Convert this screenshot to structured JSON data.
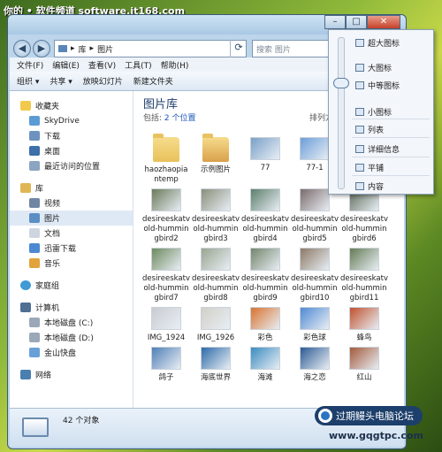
{
  "watermark": {
    "top_text": "你的 • 软件频道 software.it168.com",
    "badge_text": "过期鳗头电脑论坛",
    "url": "www.gqgtpc.com"
  },
  "window": {
    "buttons": [
      "–",
      "□",
      "✕"
    ]
  },
  "address": {
    "crumb1": "库",
    "sep": "▸",
    "crumb2": "图片",
    "search_placeholder": "搜索 图片"
  },
  "menu": [
    "文件(F)",
    "编辑(E)",
    "查看(V)",
    "工具(T)",
    "帮助(H)"
  ],
  "toolbar": [
    "组织 ▾",
    "共享 ▾",
    "放映幻灯片",
    "新建文件夹"
  ],
  "nav": {
    "favorites": "收藏夹",
    "fav_items": [
      "SkyDrive",
      "下载",
      "桌面",
      "最近访问的位置"
    ],
    "library": "库",
    "lib_items": [
      "视频",
      "图片",
      "文档",
      "迅雷下载",
      "音乐"
    ],
    "homegroup": "家庭组",
    "computer": "计算机",
    "comp_items": [
      "本地磁盘 (C:)",
      "本地磁盘 (D:)",
      "金山快盘"
    ],
    "network": "网络"
  },
  "library": {
    "title": "图片库",
    "subtitle_prefix": "包括: ",
    "subtitle_link": "2 个位置",
    "arrange": "排列方"
  },
  "files": [
    {
      "name": "haozhaopiantemp",
      "kind": "folder",
      "color": "#e8c15b"
    },
    {
      "name": "示例图片",
      "kind": "folder",
      "color": "#d9a04a"
    },
    {
      "name": "77",
      "kind": "image",
      "color": "#7aa0c8"
    },
    {
      "name": "77-1",
      "kind": "image",
      "color": "#6c9ed8"
    },
    {
      "name": "",
      "kind": "blank",
      "color": "#ffffff"
    },
    {
      "name": "desireeskatvold-hummingbird2",
      "kind": "image",
      "color": "#6b7a5a"
    },
    {
      "name": "desireeskatvold-hummingbird3",
      "kind": "image",
      "color": "#8a8f7a"
    },
    {
      "name": "desireeskatvold-hummingbird4",
      "kind": "image",
      "color": "#5d7f6a"
    },
    {
      "name": "desireeskatvold-hummingbird5",
      "kind": "image",
      "color": "#7b6b6b"
    },
    {
      "name": "desireeskatvold-hummingbird6",
      "kind": "image",
      "color": "#5f6a58"
    },
    {
      "name": "desireeskatvold-hummingbird7",
      "kind": "image",
      "color": "#6d8a5e"
    },
    {
      "name": "desireeskatvold-hummingbird8",
      "kind": "image",
      "color": "#9aa590"
    },
    {
      "name": "desireeskatvold-hummingbird9",
      "kind": "image",
      "color": "#73856b"
    },
    {
      "name": "desireeskatvold-hummingbird10",
      "kind": "image",
      "color": "#8d7a66"
    },
    {
      "name": "desireeskatvold-hummingbird11",
      "kind": "image",
      "color": "#667c56"
    },
    {
      "name": "IMG_1924",
      "kind": "image",
      "color": "#c9ccd1"
    },
    {
      "name": "IMG_1926",
      "kind": "image",
      "color": "#d2cfc8"
    },
    {
      "name": "彩色",
      "kind": "image",
      "color": "#d8732f"
    },
    {
      "name": "彩色球",
      "kind": "image",
      "color": "#4f8ad3"
    },
    {
      "name": "蜂鸟",
      "kind": "image",
      "color": "#c0522f"
    },
    {
      "name": "鸽子",
      "kind": "image",
      "color": "#4f7fb6"
    },
    {
      "name": "海底世界",
      "kind": "image",
      "color": "#2d6aa8"
    },
    {
      "name": "海滩",
      "kind": "image",
      "color": "#3a8cc0"
    },
    {
      "name": "海之恋",
      "kind": "image",
      "color": "#2c5a94"
    },
    {
      "name": "红山",
      "kind": "image",
      "color": "#a35a3c"
    }
  ],
  "view_menu": [
    "超大图标",
    "大图标",
    "中等图标",
    "小图标",
    "列表",
    "详细信息",
    "平铺",
    "内容"
  ],
  "status": {
    "count": "42 个对象"
  }
}
